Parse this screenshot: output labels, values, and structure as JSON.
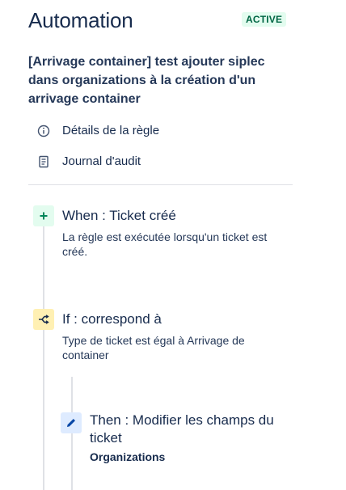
{
  "header": {
    "title": "Automation",
    "status_badge": "ACTIVE"
  },
  "rule": {
    "name": "[Arrivage container] test ajouter siplec dans organizations à la création d'un arrivage container"
  },
  "nav": {
    "items": [
      {
        "label": "Détails de la règle",
        "icon": "info-icon"
      },
      {
        "label": "Journal d'audit",
        "icon": "document-icon"
      }
    ]
  },
  "steps": {
    "trigger": {
      "title": "When : Ticket créé",
      "description": "La règle est exécutée lorsqu'un ticket est créé.",
      "icon": "plus-icon"
    },
    "condition": {
      "title": "If : correspond à",
      "description": "Type de ticket est égal à Arrivage de container",
      "icon": "branch-icon"
    },
    "action": {
      "title": "Then : Modifier les champs du ticket",
      "field": "Organizations",
      "icon": "pencil-icon"
    }
  },
  "colors": {
    "badge_bg": "#e3fcef",
    "badge_text": "#006644",
    "trigger_icon_bg": "#e3fcef",
    "condition_icon_bg": "#fff0b3",
    "action_icon_bg": "#deebff"
  }
}
